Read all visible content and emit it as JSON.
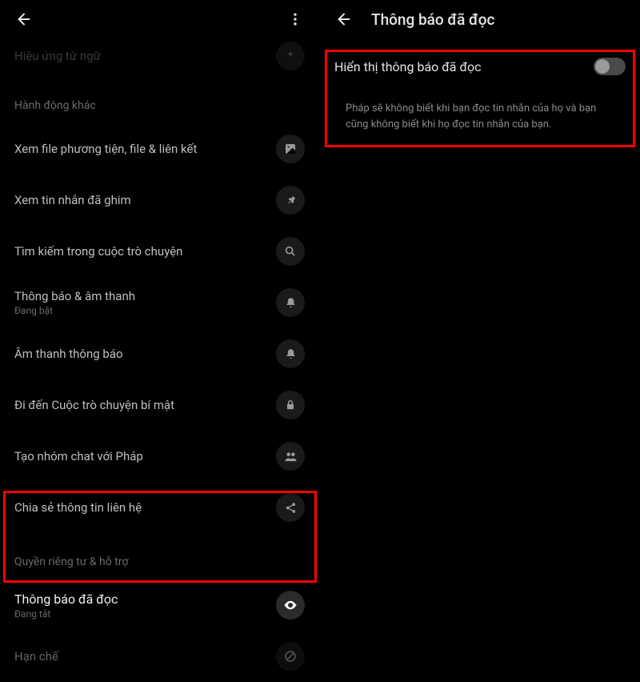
{
  "left": {
    "faded_top": "Hiệu ứng từ ngữ",
    "section1": "Hành động khác",
    "items": [
      {
        "label": "Xem file phương tiện, file & liên kết",
        "icon": "image"
      },
      {
        "label": "Xem tin nhắn đã ghim",
        "icon": "pin"
      },
      {
        "label": "Tìm kiếm trong cuộc trò chuyện",
        "icon": "search"
      },
      {
        "label": "Thông báo & âm thanh",
        "sub": "Đang bật",
        "icon": "bell"
      },
      {
        "label": "Âm thanh thông báo",
        "icon": "bell"
      },
      {
        "label": "Đi đến Cuộc trò chuyện bí mật",
        "icon": "lock"
      },
      {
        "label": "Tạo nhóm chat với Pháp",
        "icon": "group"
      },
      {
        "label": "Chia sẻ thông tin liên hệ",
        "icon": "share"
      }
    ],
    "section2": "Quyền riêng tư & hỗ trợ",
    "read": {
      "label": "Thông báo đã đọc",
      "sub": "Đang tắt",
      "icon": "eye"
    },
    "restrict": {
      "label": "Hạn chế",
      "icon": "block"
    }
  },
  "right": {
    "title": "Thông báo đã đọc",
    "toggle_label": "Hiển thị thông báo đã đọc",
    "toggle_on": false,
    "desc": "Pháp sẽ không biết khi bạn đọc tin nhắn của họ và bạn cũng không biết khi họ đọc tin nhắn của bạn."
  }
}
